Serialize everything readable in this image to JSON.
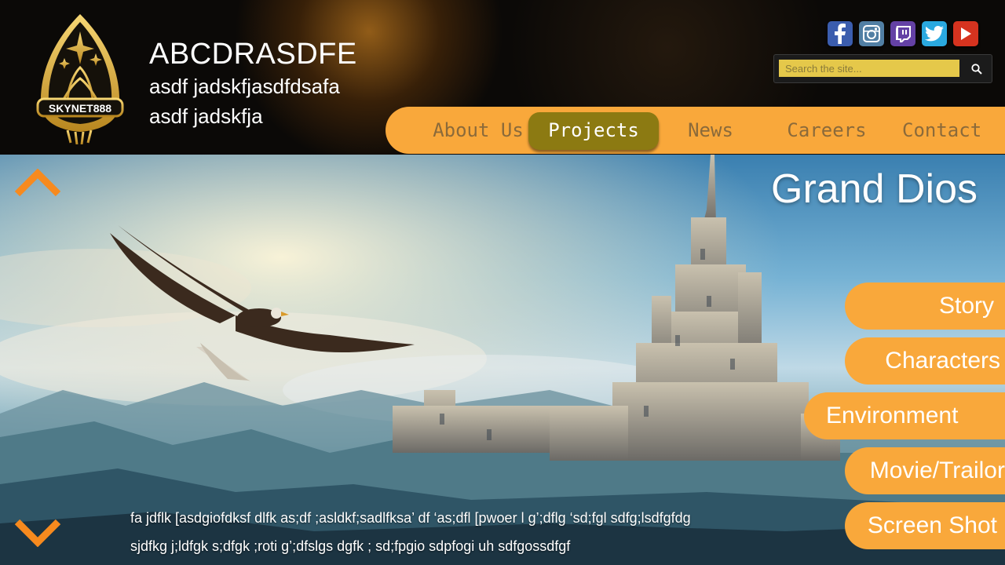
{
  "header": {
    "logo_text": "SKYNET888",
    "title": "ABCDRASDFE",
    "subtitle_line1": "asdf jadskfjasdfdsafa",
    "subtitle_line2": "asdf jadskfja"
  },
  "social": [
    {
      "name": "facebook-icon",
      "color": "#3b5dae"
    },
    {
      "name": "instagram-icon",
      "color": "#517fa4"
    },
    {
      "name": "twitch-icon",
      "color": "#6441a5"
    },
    {
      "name": "twitter-icon",
      "color": "#2aa9e0"
    },
    {
      "name": "youtube-icon",
      "color": "#d6331f"
    }
  ],
  "search": {
    "placeholder": "Search the site...",
    "value": ""
  },
  "nav": {
    "items": [
      "About Us",
      "Projects",
      "News",
      "Careers",
      "Contact"
    ],
    "active": "Projects"
  },
  "hero": {
    "title": "Grand Dios",
    "description_line1": "fa jdflk [asdgiofdksf dlfk as;df    ;asldkf;sadlfksa’ df ‘as;dfl [pwoer l g’;dflg ‘sd;fgl sdfg;lsdfgfdg",
    "description_line2": "sjdfkg j;ldfgk s;dfgk ;roti  g’;dfslgs dgfk ; sd;fpgio sdpfogi uh  sdfgossdfgf"
  },
  "side_menu": [
    "Story",
    "Characters",
    "Environment",
    "Movie/Trailor",
    "Screen Shot"
  ],
  "colors": {
    "accent_orange": "#f9a83b",
    "active_nav": "#8c7a12",
    "nav_text": "#8b6a3a",
    "search_field": "#e5c84a"
  }
}
